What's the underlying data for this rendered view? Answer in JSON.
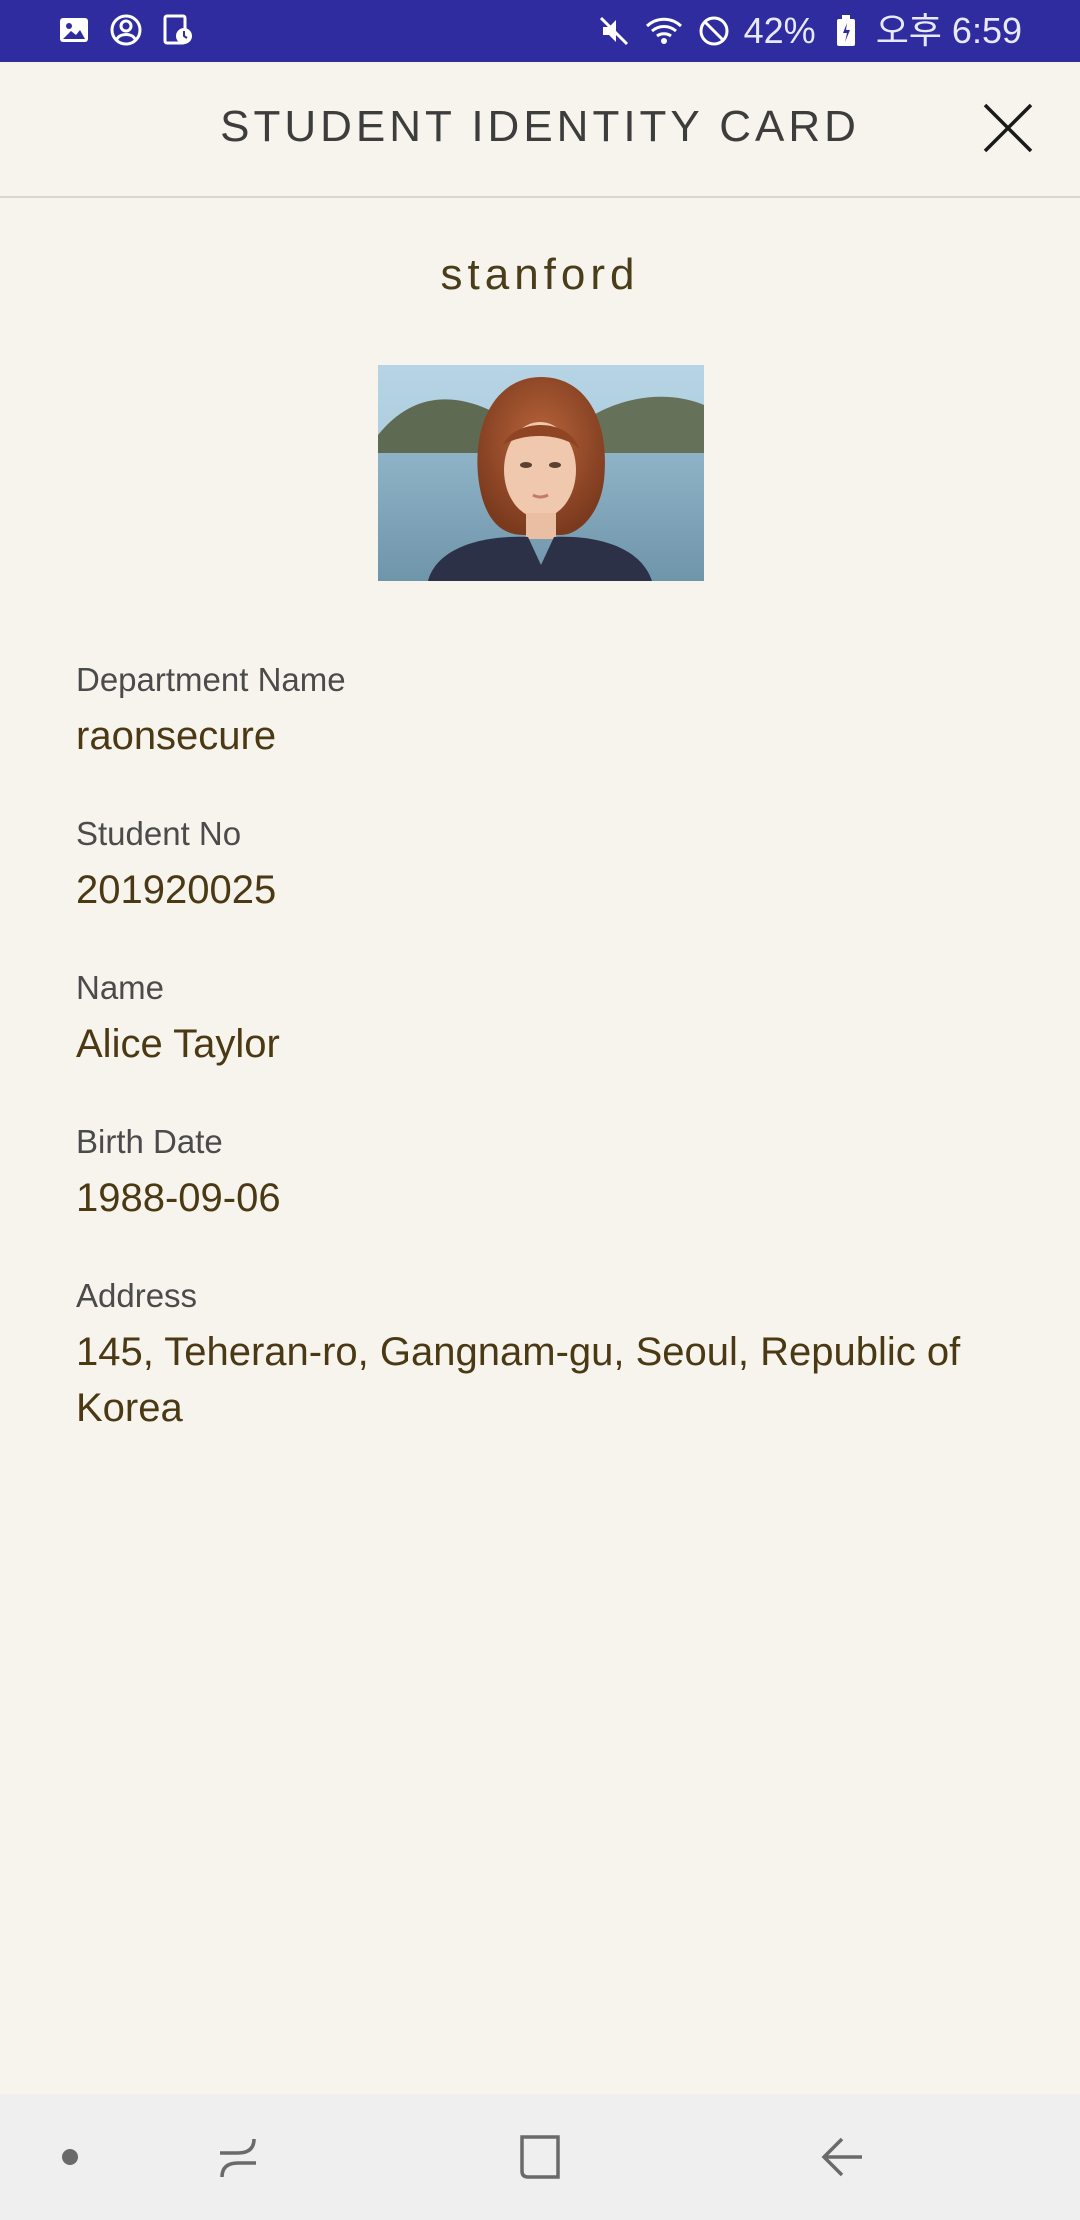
{
  "status_bar": {
    "battery": "42%",
    "time": "오후 6:59",
    "icons": [
      "gallery-icon",
      "account-circle-icon",
      "screen-record-icon",
      "mute-icon",
      "wifi-icon",
      "do-not-disturb-icon",
      "battery-icon"
    ]
  },
  "header": {
    "title": "STUDENT IDENTITY CARD",
    "close_icon": "close-icon"
  },
  "card": {
    "school": "stanford",
    "fields": [
      {
        "label": "Department Name",
        "value": "raonsecure"
      },
      {
        "label": "Student No",
        "value": "201920025"
      },
      {
        "label": "Name",
        "value": "Alice Taylor"
      },
      {
        "label": "Birth Date",
        "value": "1988-09-06"
      },
      {
        "label": "Address",
        "value": "145, Teheran-ro, Gangnam-gu, Seoul, Republic of Korea"
      }
    ]
  },
  "nav_bar": {
    "icons": [
      "dot-icon",
      "recent-apps-icon",
      "home-icon",
      "back-icon"
    ]
  },
  "colors": {
    "status_bar": "#2e2c9e",
    "background": "#f7f4ee",
    "value_text": "#4a3913",
    "label_text": "#4b4b4b",
    "nav_bar": "#efefef"
  }
}
